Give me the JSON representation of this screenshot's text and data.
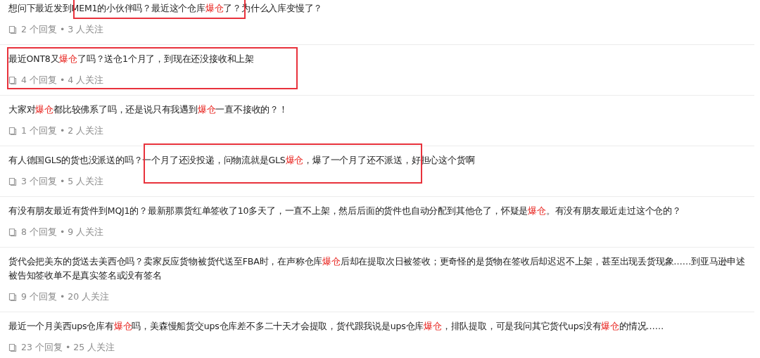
{
  "questions": [
    {
      "title": [
        {
          "kind": "plain",
          "text": "想问下最近发到MEM1的小伙伴吗？最近这个仓库"
        },
        {
          "kind": "keyword",
          "text": "爆仓"
        },
        {
          "kind": "plain",
          "text": "了？为什么入库变慢了？"
        }
      ],
      "replies": "2 个回复",
      "separator": "•",
      "followers": "3 人关注",
      "highlighted": true
    },
    {
      "title": [
        {
          "kind": "plain",
          "text": "最近ONT8又"
        },
        {
          "kind": "keyword",
          "text": "爆仓"
        },
        {
          "kind": "plain",
          "text": "了吗？送仓1个月了，到现在还没接收和上架"
        }
      ],
      "replies": "4 个回复",
      "separator": "•",
      "followers": "4 人关注",
      "highlighted": true
    },
    {
      "title": [
        {
          "kind": "plain",
          "text": "大家对"
        },
        {
          "kind": "keyword",
          "text": "爆仓"
        },
        {
          "kind": "plain",
          "text": "都比较佛系了吗，还是说只有我遇到"
        },
        {
          "kind": "keyword",
          "text": "爆仓"
        },
        {
          "kind": "plain",
          "text": "一直不接收的？！"
        }
      ],
      "replies": "1 个回复",
      "separator": "•",
      "followers": "2 人关注",
      "highlighted": false
    },
    {
      "title": [
        {
          "kind": "plain",
          "text": "有人德国GLS的货也没派送的吗？一个月了还没投递，问物流就是GLS"
        },
        {
          "kind": "keyword",
          "text": "爆仓"
        },
        {
          "kind": "plain",
          "text": "，爆了一个月了还不派送，好担心这个货啊"
        }
      ],
      "replies": "3 个回复",
      "separator": "•",
      "followers": "5 人关注",
      "highlighted": true
    },
    {
      "title": [
        {
          "kind": "plain",
          "text": "有没有朋友最近有货件到MQJ1的？最新那票货红单签收了10多天了，一直不上架，然后后面的货件也自动分配到其他仓了，怀疑是"
        },
        {
          "kind": "keyword",
          "text": "爆仓"
        },
        {
          "kind": "plain",
          "text": "。有没有朋友最近走过这个仓的？"
        }
      ],
      "replies": "8 个回复",
      "separator": "•",
      "followers": "9 人关注",
      "highlighted": false
    },
    {
      "title": [
        {
          "kind": "plain",
          "text": "货代会把美东的货送去美西仓吗？卖家反应货物被货代送至FBA时，在声称仓库"
        },
        {
          "kind": "keyword",
          "text": "爆仓"
        },
        {
          "kind": "plain",
          "text": "后却在提取次日被签收；更奇怪的是货物在签收后却迟迟不上架，甚至出现丢货现象……到亚马逊申述被告知签收单不是真实签名或没有签名"
        }
      ],
      "replies": "9 个回复",
      "separator": "•",
      "followers": "20 人关注",
      "highlighted": false
    },
    {
      "title": [
        {
          "kind": "plain",
          "text": "最近一个月美西ups仓库有"
        },
        {
          "kind": "keyword",
          "text": "爆仓"
        },
        {
          "kind": "plain",
          "text": "吗，美森慢船货交ups仓库差不多二十天才会提取，货代跟我说是ups仓库"
        },
        {
          "kind": "keyword",
          "text": "爆仓"
        },
        {
          "kind": "plain",
          "text": "，排队提取，可是我问其它货代ups没有"
        },
        {
          "kind": "keyword",
          "text": "爆仓"
        },
        {
          "kind": "plain",
          "text": "的情况……"
        }
      ],
      "replies": "23 个回复",
      "separator": "•",
      "followers": "25 人关注",
      "highlighted": false
    }
  ]
}
